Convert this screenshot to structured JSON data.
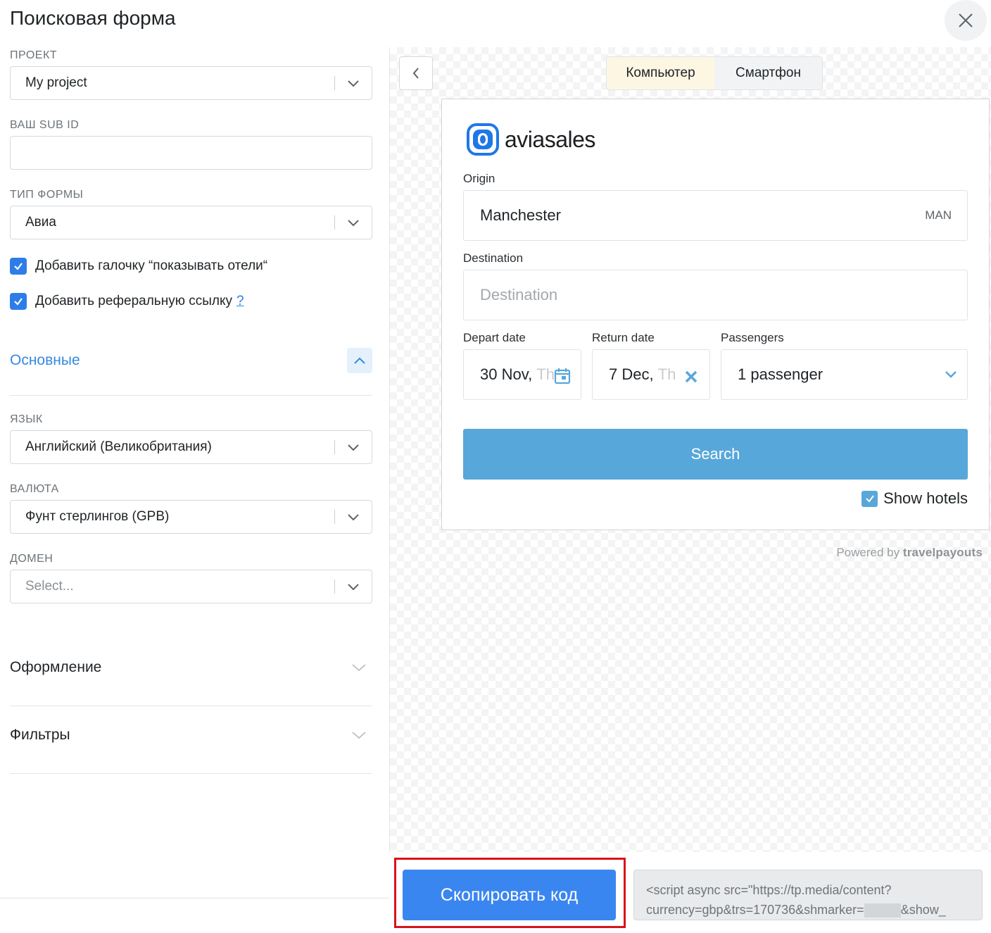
{
  "header": {
    "title": "Поисковая форма"
  },
  "left": {
    "project": {
      "label": "ПРОЕКТ",
      "value": "My project"
    },
    "subid": {
      "label": "ВАШ SUB ID",
      "value": ""
    },
    "form_type": {
      "label": "ТИП ФОРМЫ",
      "value": "Авиа"
    },
    "checkbox_hotels": {
      "label": "Добавить галочку “показывать отели“",
      "checked": true
    },
    "checkbox_referral": {
      "label": "Добавить реферальную ссылку",
      "help": "?",
      "checked": true
    },
    "section_main": {
      "title": "Основные",
      "expanded": true
    },
    "language": {
      "label": "ЯЗЫК",
      "value": "Английский (Великобритания)"
    },
    "currency": {
      "label": "ВАЛЮТА",
      "value": "Фунт стерлингов (GPB)"
    },
    "domain": {
      "label": "ДОМЕН",
      "placeholder": "Select..."
    },
    "section_design": {
      "title": "Оформление"
    },
    "section_filters": {
      "title": "Фильтры"
    }
  },
  "preview": {
    "tabs": [
      {
        "label": "Компьютер",
        "active": true
      },
      {
        "label": "Смартфон",
        "active": false
      }
    ],
    "widget": {
      "brand": "aviasales",
      "origin": {
        "label": "Origin",
        "value": "Manchester",
        "iata": "MAN"
      },
      "destination": {
        "label": "Destination",
        "placeholder": "Destination"
      },
      "depart": {
        "label": "Depart date",
        "value": "30 Nov,",
        "value_faded": "Th"
      },
      "return": {
        "label": "Return date",
        "value": "7 Dec,",
        "value_faded": "Th"
      },
      "passengers": {
        "label": "Passengers",
        "value": "1 passenger"
      },
      "search_label": "Search",
      "show_hotels": {
        "label": "Show hotels",
        "checked": true
      }
    },
    "powered_prefix": "Powered by",
    "powered_brand": "travelpayouts"
  },
  "footer": {
    "copy_button": "Скопировать код",
    "code_line1": "<script async src=\"https://tp.media/content?",
    "code_line2_a": "currency=gbp&trs=170736&shmarker=",
    "code_line2_b": "&show_"
  },
  "colors": {
    "accent": "#3a86f1",
    "widget_accent": "#58a7da",
    "highlight": "#d8131b"
  }
}
